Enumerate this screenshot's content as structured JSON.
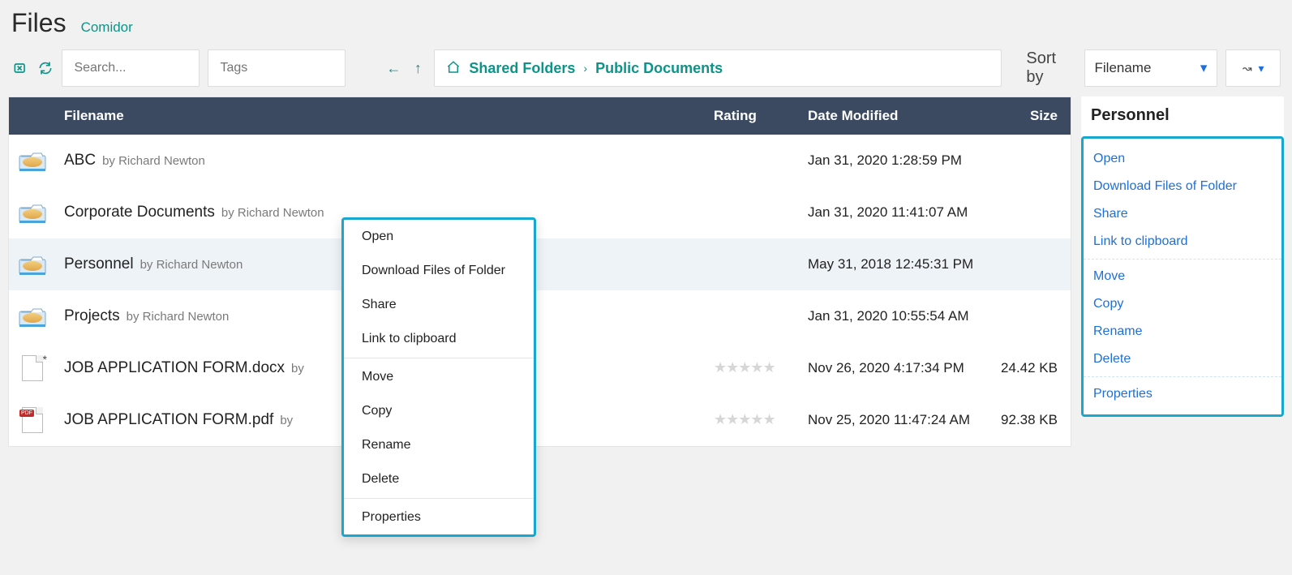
{
  "header": {
    "title": "Files",
    "brand": "Comidor"
  },
  "toolbar": {
    "search_placeholder": "Search...",
    "tags_placeholder": "Tags",
    "sort_label": "Sort by",
    "sort_value": "Filename"
  },
  "breadcrumb": {
    "items": [
      "Shared Folders",
      "Public Documents"
    ]
  },
  "columns": {
    "filename": "Filename",
    "rating": "Rating",
    "date": "Date Modified",
    "size": "Size"
  },
  "rows": [
    {
      "type": "folder",
      "name": "ABC",
      "by": "by Richard Newton",
      "date": "Jan 31, 2020 1:28:59 PM",
      "size": "",
      "rated": false
    },
    {
      "type": "folder",
      "name": "Corporate Documents",
      "by": "by Richard Newton",
      "date": "Jan 31, 2020 11:41:07 AM",
      "size": "",
      "rated": false
    },
    {
      "type": "folder",
      "name": "Personnel",
      "by": "by Richard Newton",
      "date": "May 31, 2018 12:45:31 PM",
      "size": "",
      "rated": false,
      "selected": true
    },
    {
      "type": "folder",
      "name": "Projects",
      "by": "by Richard Newton",
      "date": "Jan 31, 2020 10:55:54 AM",
      "size": "",
      "rated": false
    },
    {
      "type": "docx",
      "name": "JOB APPLICATION FORM.docx",
      "by": "by",
      "date": "Nov 26, 2020 4:17:34 PM",
      "size": "24.42 KB",
      "rated": true
    },
    {
      "type": "pdf",
      "name": "JOB APPLICATION FORM.pdf",
      "by": "by",
      "date": "Nov 25, 2020 11:47:24 AM",
      "size": "92.38 KB",
      "rated": true
    }
  ],
  "context_menu": {
    "groups": [
      [
        "Open",
        "Download Files of Folder",
        "Share",
        "Link to clipboard"
      ],
      [
        "Move",
        "Copy",
        "Rename",
        "Delete"
      ],
      [
        "Properties"
      ]
    ]
  },
  "side_panel": {
    "title": "Personnel",
    "groups": [
      [
        "Open",
        "Download Files of Folder",
        "Share",
        "Link to clipboard"
      ],
      [
        "Move",
        "Copy",
        "Rename",
        "Delete"
      ],
      [
        "Properties"
      ]
    ]
  }
}
